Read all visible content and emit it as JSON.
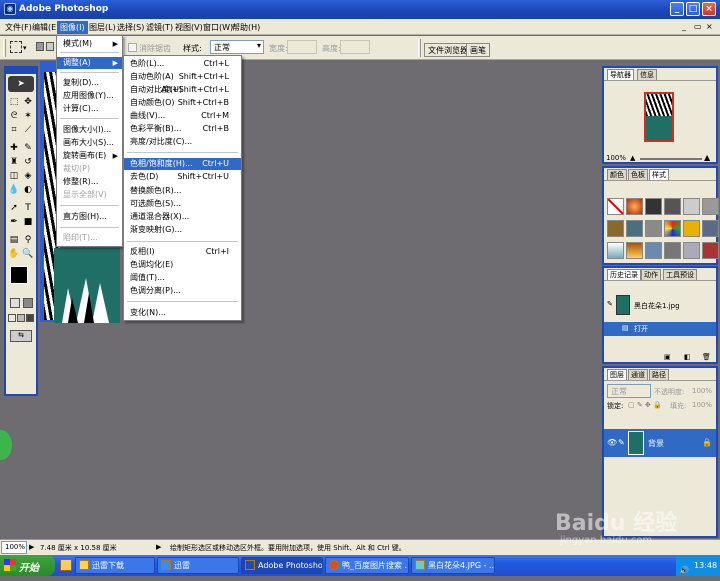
{
  "window": {
    "title": "Adobe Photoshop"
  },
  "menubar": [
    "文件(F)",
    "编辑(E)",
    "图像(I)",
    "图层(L)",
    "选择(S)",
    "滤镜(T)",
    "视图(V)",
    "窗口(W)",
    "帮助(H)"
  ],
  "options": {
    "antialias_label": "消除锯齿",
    "style_label": "样式:",
    "style_value": "正常",
    "width_label": "宽度:",
    "height_label": "高度:",
    "tab_browser": "文件浏览器",
    "tab_brushes": "画笔"
  },
  "image_menu": {
    "items": [
      "模式(M)",
      "调整(A)",
      "复制(D)...",
      "应用图像(Y)...",
      "计算(C)...",
      "图像大小(I)...",
      "画布大小(S)...",
      "旋转画布(E)",
      "裁切(P)",
      "修整(R)...",
      "显示全部(V)",
      "直方图(H)...",
      "陷印(T)..."
    ]
  },
  "adjust_menu": {
    "items": [
      {
        "label": "色阶(L)...",
        "shortcut": "Ctrl+L"
      },
      {
        "label": "自动色阶(A)",
        "shortcut": "Shift+Ctrl+L"
      },
      {
        "label": "自动对比度(U)",
        "shortcut": "Alt+Shift+Ctrl+L"
      },
      {
        "label": "自动颜色(O)",
        "shortcut": "Shift+Ctrl+B"
      },
      {
        "label": "曲线(V)...",
        "shortcut": "Ctrl+M"
      },
      {
        "label": "色彩平衡(B)...",
        "shortcut": "Ctrl+B"
      },
      {
        "label": "亮度/对比度(C)...",
        "shortcut": ""
      },
      {
        "label": "色相/饱和度(H)...",
        "shortcut": "Ctrl+U"
      },
      {
        "label": "去色(D)",
        "shortcut": "Shift+Ctrl+U"
      },
      {
        "label": "替换颜色(R)...",
        "shortcut": ""
      },
      {
        "label": "可选颜色(S)...",
        "shortcut": ""
      },
      {
        "label": "通道混合器(X)...",
        "shortcut": ""
      },
      {
        "label": "渐变映射(G)...",
        "shortcut": ""
      },
      {
        "label": "反相(I)",
        "shortcut": "Ctrl+I"
      },
      {
        "label": "色调均化(E)",
        "shortcut": ""
      },
      {
        "label": "阈值(T)...",
        "shortcut": ""
      },
      {
        "label": "色调分离(P)...",
        "shortcut": ""
      },
      {
        "label": "变化(N)...",
        "shortcut": ""
      }
    ]
  },
  "navigator": {
    "tab1": "导航器",
    "tab2": "信息",
    "zoom": "100%"
  },
  "swatches": {
    "tab1": "颜色",
    "tab2": "色板",
    "tab3": "样式"
  },
  "history": {
    "tab1": "历史记录",
    "tab2": "动作",
    "tab3": "工具预设",
    "snapshot": "黑白花朵1.jpg",
    "step": "打开"
  },
  "layers": {
    "tab1": "图层",
    "tab2": "通道",
    "tab3": "路径",
    "mode": "正常",
    "opacity_label": "不透明度:",
    "opacity": "100%",
    "lock_label": "锁定:",
    "fill_label": "填充:",
    "fill": "100%",
    "layer_name": "背景"
  },
  "status": {
    "zoom": "100%",
    "size": "7.48 厘米 x 10.58 厘米",
    "hint": "绘制矩形选区或移动选区外框。要用附加选项，使用 Shift、Alt 和 Ctrl 键。"
  },
  "taskbar": {
    "start": "开始",
    "tasks": [
      "迅雷下载",
      "迅雷",
      "Adobe Photoshop",
      "鸭_百度图片搜索 ...",
      "黑白花朵4.JPG - ..."
    ],
    "clock": "13:48"
  },
  "watermark": {
    "line1": "Baidu 经验",
    "line2": "jingyan.baidu.com"
  },
  "colors": {
    "title_blue": "#2a5fd6",
    "highlight": "#316ac5",
    "teal": "#1f6f66",
    "workspace": "#6f6c71"
  }
}
